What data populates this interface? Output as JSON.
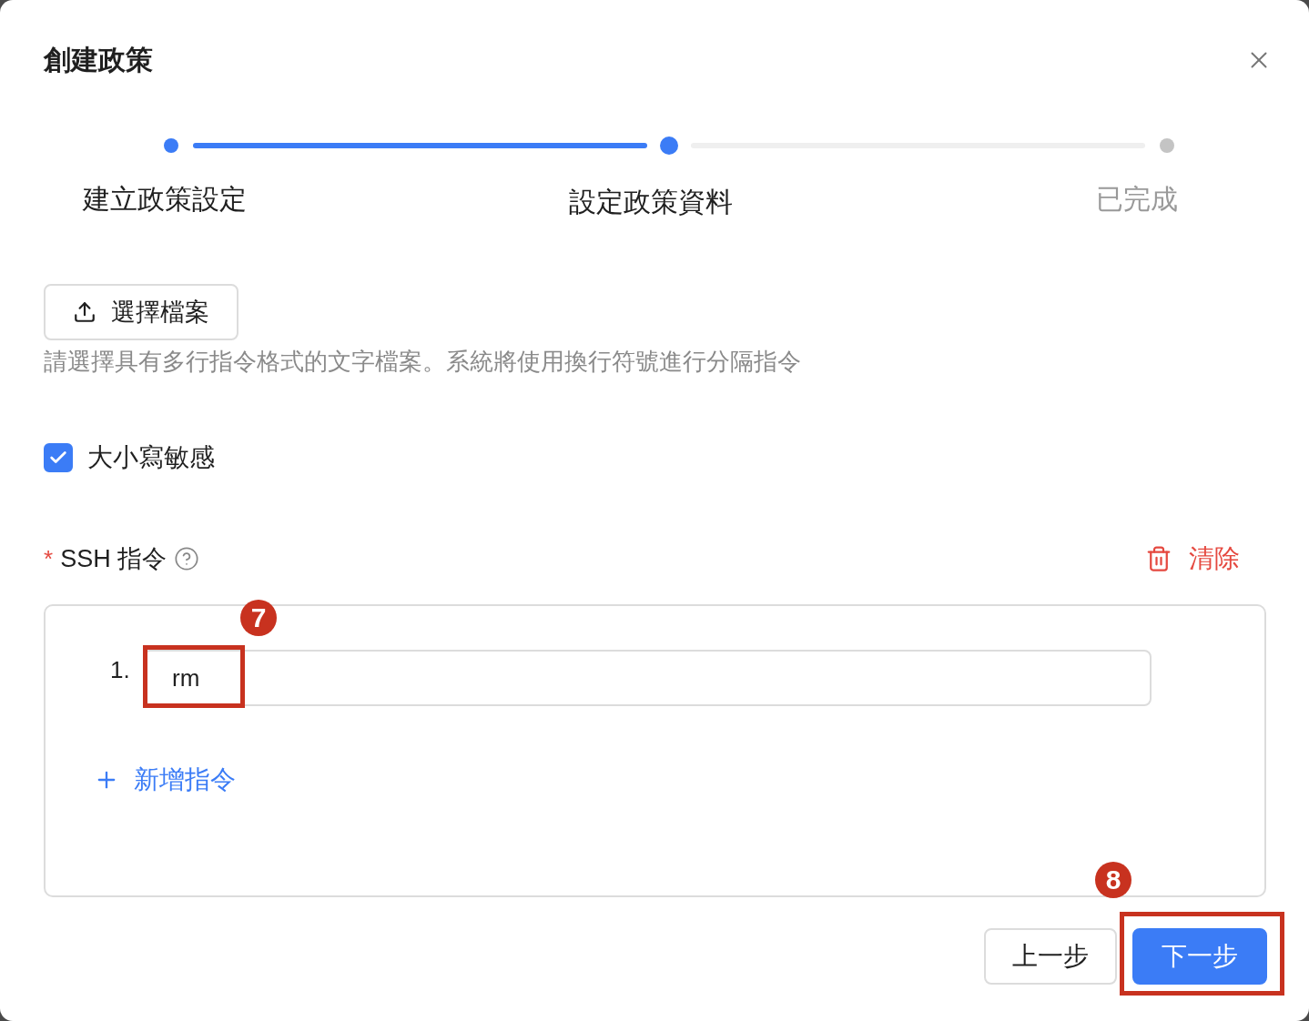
{
  "dialog": {
    "title": "創建政策"
  },
  "steps": [
    {
      "label": "建立政策設定",
      "completed": true,
      "selected": false
    },
    {
      "label": "設定政策資料",
      "completed": false,
      "selected": true
    },
    {
      "label": "已完成",
      "completed": false,
      "selected": false
    }
  ],
  "upload": {
    "label": "選擇檔案",
    "hint": "請選擇具有多行指令格式的文字檔案。系統將使用換行符號進行分隔指令"
  },
  "case_sensitive": {
    "label": "大小寫敏感",
    "checked": true
  },
  "ssh_commands": {
    "label": "SSH 指令",
    "required_mark": "*",
    "clear_label": "清除",
    "items": [
      {
        "number": "1.",
        "value": "rm",
        "annotation": "7"
      }
    ],
    "add_label": "新增指令"
  },
  "footer": {
    "buttons": [
      {
        "label": "上一步",
        "kind": "secondary"
      },
      {
        "label": "下一步",
        "kind": "primary",
        "annotation": "8"
      }
    ]
  }
}
